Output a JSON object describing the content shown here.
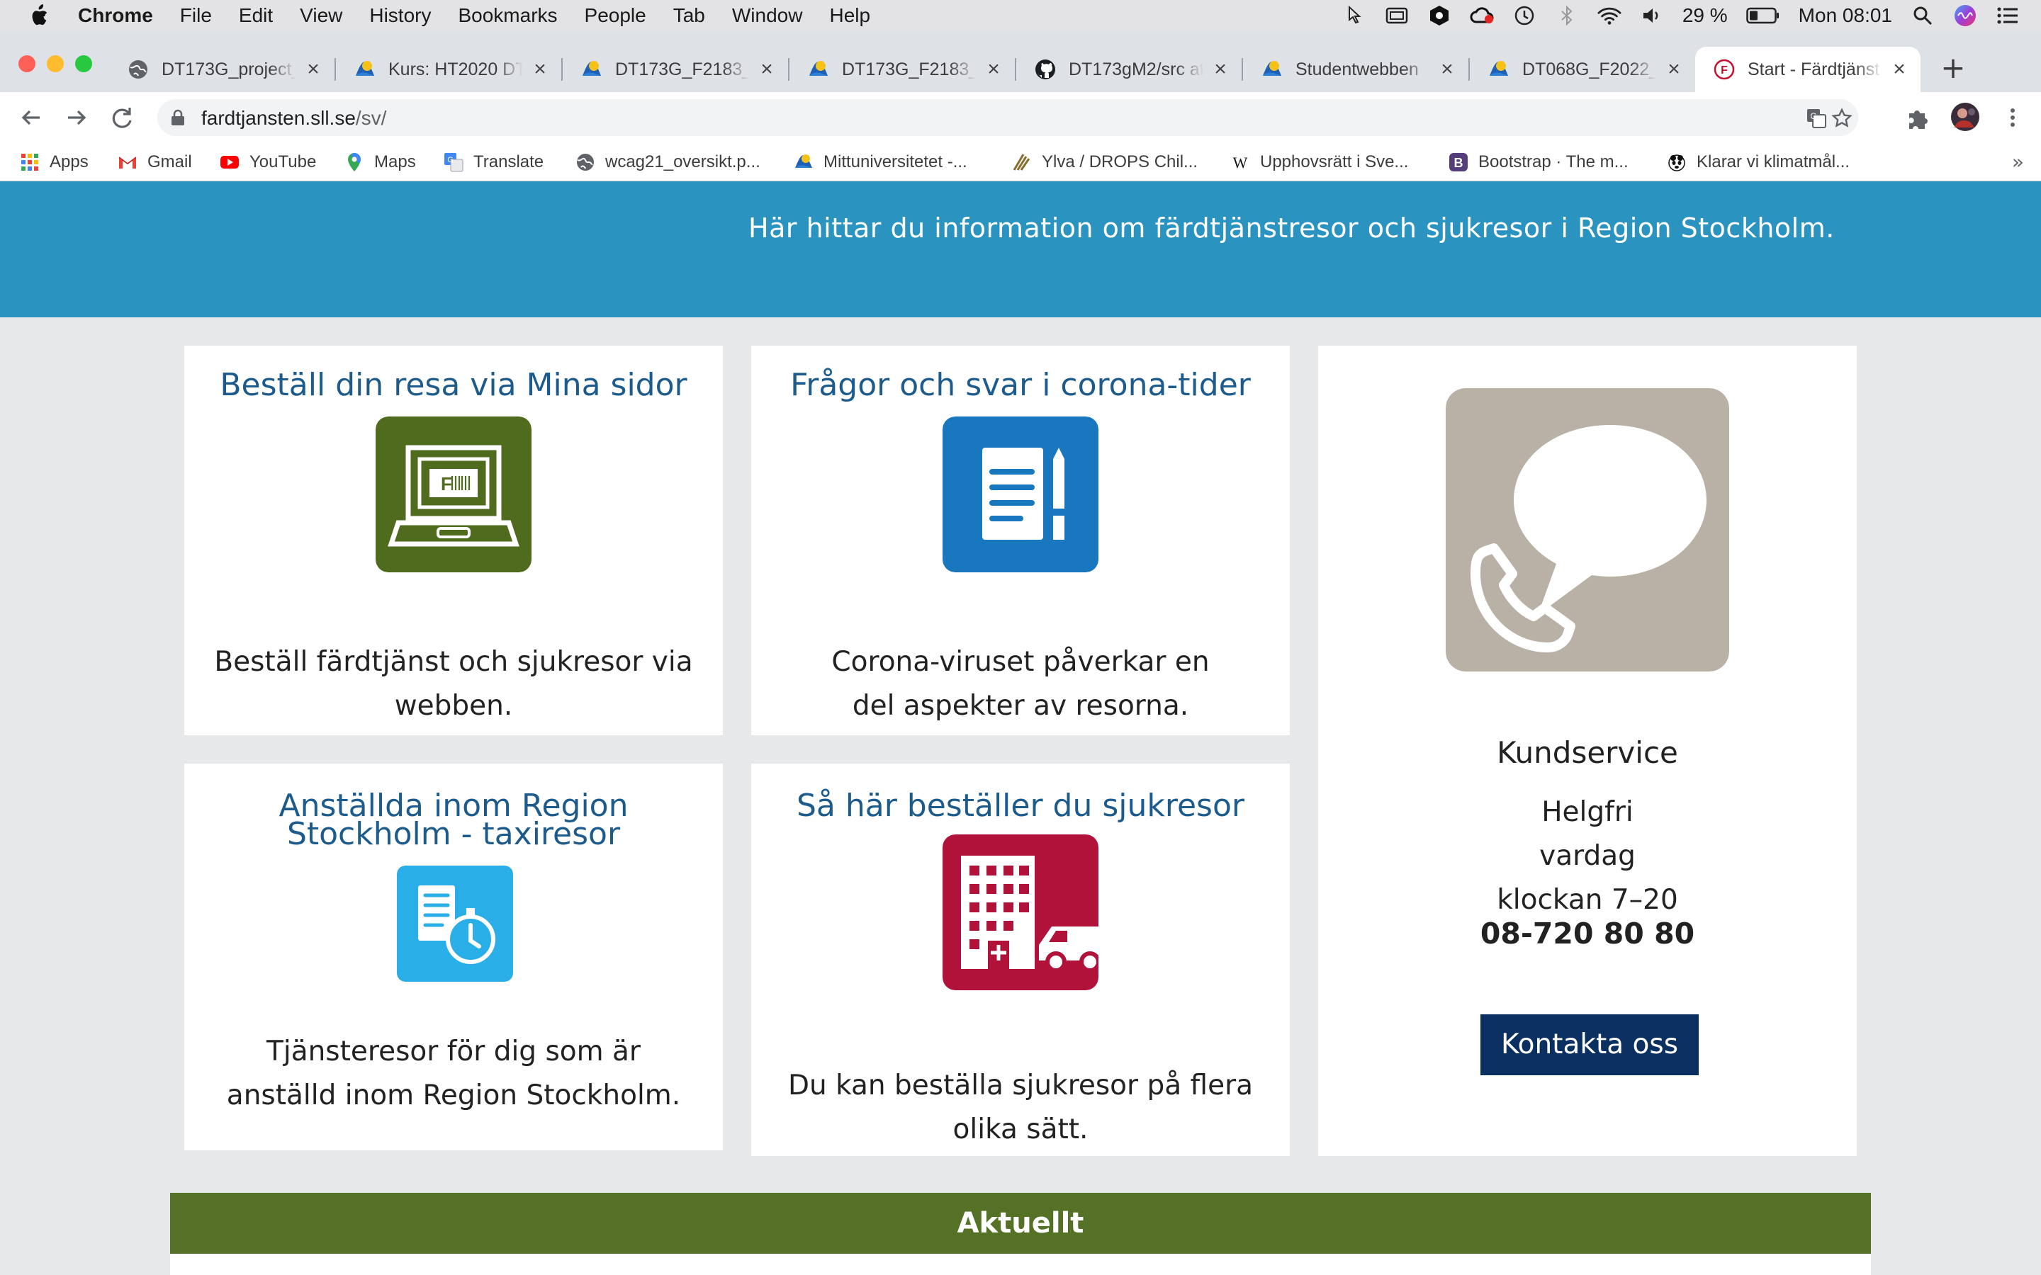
{
  "menubar": {
    "app": "Chrome",
    "items": [
      "File",
      "Edit",
      "View",
      "History",
      "Bookmarks",
      "People",
      "Tab",
      "Window",
      "Help"
    ],
    "battery_pct": "29 %",
    "clock": "Mon 08:01"
  },
  "tabs": [
    {
      "title": "DT173G_project_",
      "favicon": "globe-icon"
    },
    {
      "title": "Kurs: HT2020 DT",
      "favicon": "miun-icon"
    },
    {
      "title": "DT173G_F2183_I",
      "favicon": "miun-icon"
    },
    {
      "title": "DT173G_F2183_I",
      "favicon": "miun-icon"
    },
    {
      "title": "DT173gM2/src at",
      "favicon": "github-icon"
    },
    {
      "title": "Studentwebben",
      "favicon": "miun-icon"
    },
    {
      "title": "DT068G_F2022_",
      "favicon": "miun-icon"
    },
    {
      "title": "Start - Färdtjänst",
      "favicon": "fardtjanst-icon",
      "active": true
    }
  ],
  "address": {
    "host": "fardtjansten.sll.se",
    "path": "/sv/"
  },
  "bookmarks": [
    {
      "label": "Apps",
      "icon": "apps-grid-icon"
    },
    {
      "label": "Gmail",
      "icon": "gmail-icon"
    },
    {
      "label": "YouTube",
      "icon": "youtube-icon"
    },
    {
      "label": "Maps",
      "icon": "maps-pin-icon"
    },
    {
      "label": "Translate",
      "icon": "translate-icon"
    },
    {
      "label": "wcag21_oversikt.p...",
      "icon": "globe-icon"
    },
    {
      "label": "Mittuniversitetet -...",
      "icon": "miun-icon"
    },
    {
      "label": "Ylva / DROPS Chil...",
      "icon": "drops-icon"
    },
    {
      "label": "Upphovsrätt i Sve...",
      "icon": "wikipedia-icon"
    },
    {
      "label": "Bootstrap · The m...",
      "icon": "bootstrap-icon"
    },
    {
      "label": "Klarar vi klimatmål...",
      "icon": "wwf-icon"
    }
  ],
  "hero": {
    "subtitle": "Här hittar du information om färdtjänstresor och sjukresor i Region Stockholm."
  },
  "cards": [
    {
      "title": "Beställ din resa via Mina sidor",
      "text": "Beställ färdtjänst och sjukresor via webben.",
      "icon": "laptop-booking-icon",
      "icon_color": "#4e6b1e"
    },
    {
      "title": "Frågor och svar i corona-tider",
      "text": "Corona-viruset påverkar en del aspekter av resorna.",
      "icon": "document-pencil-icon",
      "icon_color": "#1977c0"
    },
    {
      "title": "Anställda inom Region Stockholm - taxiresor",
      "text": "Tjänsteresor för dig som är anställd inom Region Stockholm.",
      "icon": "document-stopwatch-icon",
      "icon_color": "#29aee8"
    },
    {
      "title": "Så här beställer du sjukresor",
      "text": "Du kan beställa sjukresor på flera olika sätt.",
      "icon": "hospital-car-icon",
      "icon_color": "#b0123a"
    }
  ],
  "kundservice": {
    "title": "Kundservice",
    "hours": "Helgfri vardag klockan 7–20",
    "phone": "08-720 80 80",
    "button": "Kontakta oss",
    "icon": "phone-speech-icon",
    "icon_color": "#bab1a6"
  },
  "aktuellt": {
    "heading": "Aktuellt"
  },
  "colors": {
    "hero_bg": "#2a93c0",
    "link_title": "#1c5b8c",
    "button_bg": "#0a3062",
    "aktuellt_bg": "#557125"
  }
}
